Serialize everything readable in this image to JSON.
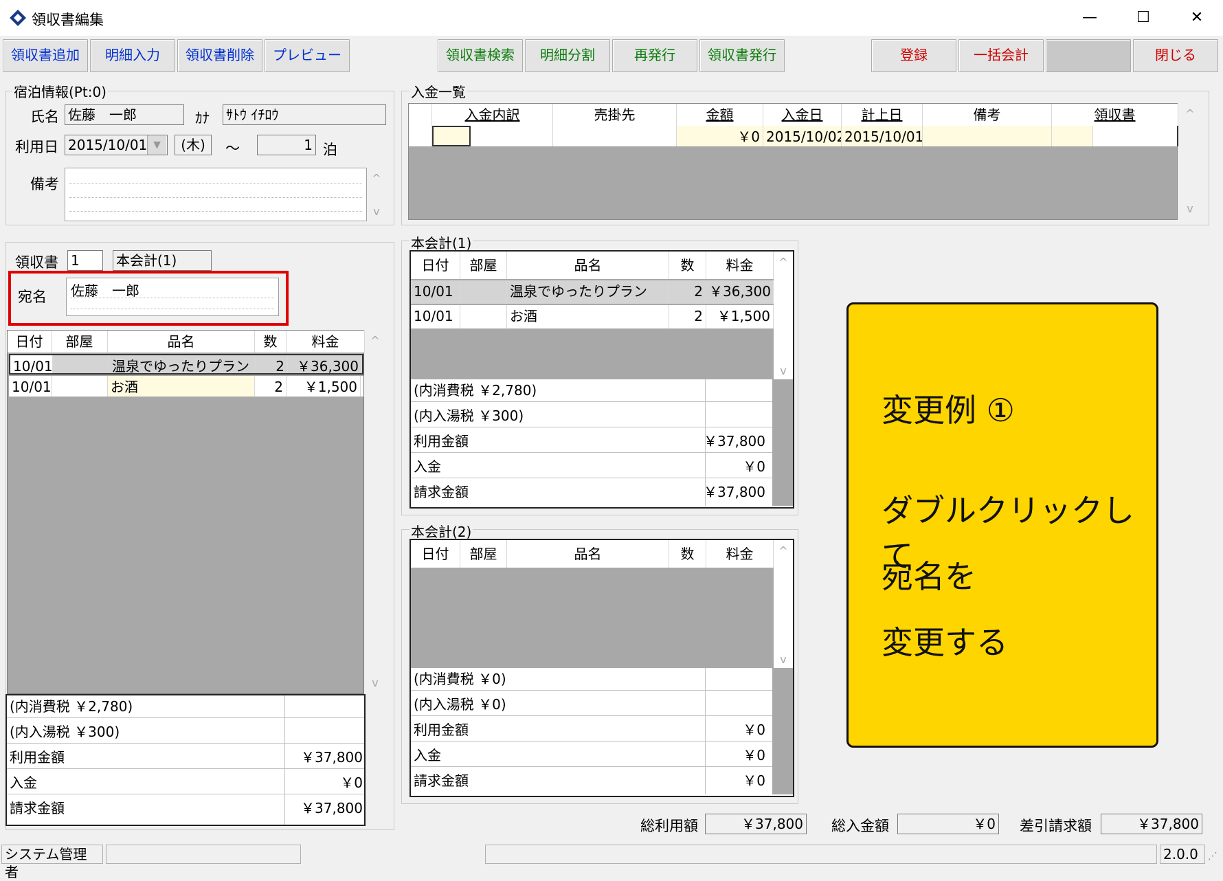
{
  "window": {
    "title": "領収書編集",
    "minimize": "—",
    "maximize": "☐",
    "close": "✕"
  },
  "toolbar": {
    "left": [
      "領収書追加",
      "明細入力",
      "領収書削除",
      "プレビュー"
    ],
    "middle": [
      "領収書検索",
      "明細分割",
      "再発行",
      "領収書発行"
    ],
    "right": [
      "登録",
      "一括会計",
      "",
      "閉じる"
    ]
  },
  "lodging": {
    "group_label": "宿泊情報(Pt:0)",
    "name_label": "氏名",
    "name": "佐藤　一郎",
    "kana_label": "ｶﾅ",
    "kana": "ｻﾄｳ ｲﾁﾛｳ",
    "date_label": "利用日",
    "date": "2015/10/01",
    "weekday": "(木)",
    "tilde": "～",
    "nights": "1",
    "nights_unit": "泊",
    "memo_label": "備考"
  },
  "receipt": {
    "label": "領収書",
    "number": "1",
    "account": "本会計(1)",
    "addressee_label": "宛名",
    "addressee": "佐藤　一郎",
    "headers": [
      "日付",
      "部屋",
      "品名",
      "数",
      "料金"
    ],
    "rows": [
      {
        "date": "10/01",
        "room": "",
        "item": "温泉でゆったりプラン",
        "qty": "2",
        "price": "￥36,300"
      },
      {
        "date": "10/01",
        "room": "",
        "item": "お酒",
        "qty": "2",
        "price": "￥1,500"
      }
    ],
    "summary": [
      {
        "label": "(内消費税 ￥2,780)",
        "value": ""
      },
      {
        "label": "(内入湯税 ￥300)",
        "value": ""
      },
      {
        "label": "利用金額",
        "value": "￥37,800"
      },
      {
        "label": "入金",
        "value": "￥0"
      },
      {
        "label": "請求金額",
        "value": "￥37,800"
      }
    ]
  },
  "payments": {
    "group_label": "入金一覧",
    "headers": [
      "入金内訳",
      "売掛先",
      "金額",
      "入金日",
      "計上日",
      "備考",
      "領収書"
    ],
    "row": {
      "amount": "￥0",
      "paid_date": "2015/10/02",
      "post_date": "2015/10/01"
    }
  },
  "account1": {
    "group_label": "本会計(1)",
    "headers": [
      "日付",
      "部屋",
      "品名",
      "数",
      "料金"
    ],
    "rows": [
      {
        "date": "10/01",
        "room": "",
        "item": "温泉でゆったりプラン",
        "qty": "2",
        "price": "￥36,300"
      },
      {
        "date": "10/01",
        "room": "",
        "item": "お酒",
        "qty": "2",
        "price": "￥1,500"
      }
    ],
    "summary": [
      {
        "label": "(内消費税 ￥2,780)",
        "value": ""
      },
      {
        "label": "(内入湯税 ￥300)",
        "value": ""
      },
      {
        "label": "利用金額",
        "value": "￥37,800"
      },
      {
        "label": "入金",
        "value": "￥0"
      },
      {
        "label": "請求金額",
        "value": "￥37,800"
      }
    ]
  },
  "account2": {
    "group_label": "本会計(2)",
    "headers": [
      "日付",
      "部屋",
      "品名",
      "数",
      "料金"
    ],
    "summary": [
      {
        "label": "(内消費税 ￥0)",
        "value": ""
      },
      {
        "label": "(内入湯税 ￥0)",
        "value": ""
      },
      {
        "label": "利用金額",
        "value": "￥0"
      },
      {
        "label": "入金",
        "value": "￥0"
      },
      {
        "label": "請求金額",
        "value": "￥0"
      }
    ]
  },
  "note": {
    "lines": [
      "変更例 ①",
      "ダブルクリックして",
      "宛名を",
      "変更する"
    ]
  },
  "totals": {
    "usage_label": "総利用額",
    "usage": "￥37,800",
    "paid_label": "総入金額",
    "paid": "￥0",
    "balance_label": "差引請求額",
    "balance": "￥37,800"
  },
  "status": {
    "user": "システム管理者",
    "version": "2.0.0"
  },
  "colors": {
    "highlight": "#e00000",
    "note": "#ffd500",
    "input_yellow": "#fffbe0"
  }
}
